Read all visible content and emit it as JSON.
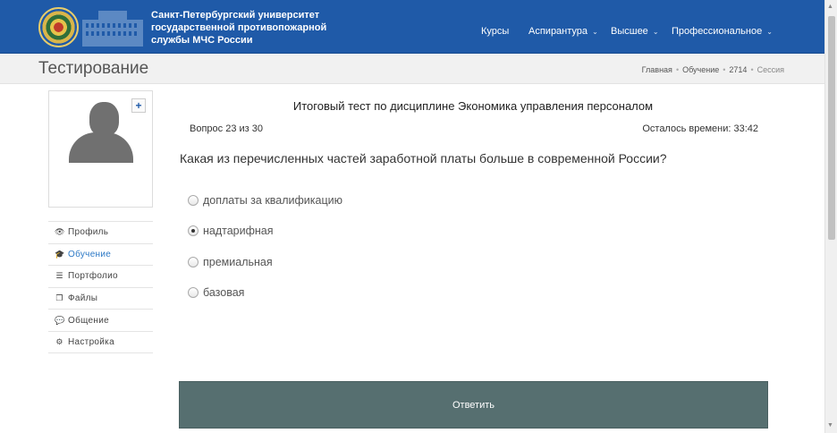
{
  "header": {
    "brand_lines": [
      "Санкт-Петербургский университет",
      "государственной противопожарной",
      "службы МЧС России"
    ],
    "nav": [
      {
        "label": "Курсы",
        "has_caret": false
      },
      {
        "label": "Аспирантура",
        "has_caret": true
      },
      {
        "label": "Высшее",
        "has_caret": true
      },
      {
        "label": "Профессиональное",
        "has_caret": true
      }
    ],
    "caret_glyph": "⌄"
  },
  "titlebar": {
    "title": "Тестирование",
    "breadcrumb": [
      "Главная",
      "Обучение",
      "2714",
      "Сессия"
    ],
    "separator": "•"
  },
  "sidebar": {
    "plus_label": "+",
    "items": [
      {
        "label": "Профиль",
        "icon": "eye-icon",
        "glyph": "👁",
        "active": false
      },
      {
        "label": "Обучение",
        "icon": "graduation-cap-icon",
        "glyph": "🎓",
        "active": true
      },
      {
        "label": "Портфолио",
        "icon": "list-icon",
        "glyph": "☰",
        "active": false
      },
      {
        "label": "Файлы",
        "icon": "files-icon",
        "glyph": "❐",
        "active": false
      },
      {
        "label": "Общение",
        "icon": "chat-icon",
        "glyph": "💬",
        "active": false
      },
      {
        "label": "Настройка",
        "icon": "gears-icon",
        "glyph": "⚙",
        "active": false
      }
    ]
  },
  "test": {
    "title": "Итоговый тест по дисциплине Экономика управления персоналом",
    "counter": "Вопрос 23 из 30",
    "timer": "Осталось времени: 33:42",
    "question": "Какая из перечисленных частей заработной платы больше в современной России?",
    "options": [
      {
        "label": "доплаты за квалификацию",
        "checked": false
      },
      {
        "label": "надтарифная",
        "checked": true
      },
      {
        "label": "премиальная",
        "checked": false
      },
      {
        "label": "базовая",
        "checked": false
      }
    ],
    "submit_label": "Ответить"
  },
  "colors": {
    "header_bg": "#1f5aa8",
    "active_link": "#2b78c5",
    "submit_bg": "#566f70"
  }
}
